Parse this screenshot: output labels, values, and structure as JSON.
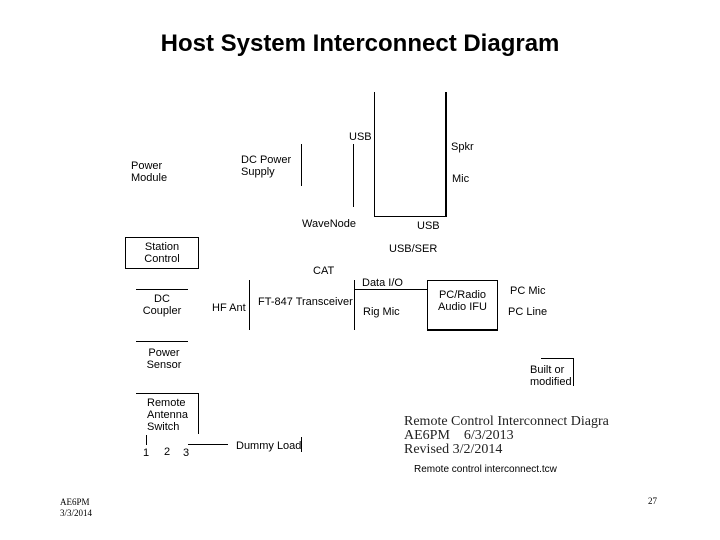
{
  "slide": {
    "title": "Host System Interconnect Diagram",
    "footer_author": "AE6PM",
    "footer_date": "3/3/2014",
    "page_number": "27"
  },
  "diagram": {
    "labels": {
      "usb_top": "USB",
      "spkr": "Spkr",
      "mic": "Mic",
      "power_module_1": "Power",
      "power_module_2": "Module",
      "dc_power_supply_1": "DC Power",
      "dc_power_supply_2": "Supply",
      "wavenode": "WaveNode",
      "usb_bottom": "USB",
      "usb_ser": "USB/SER",
      "station_control_1": "Station",
      "station_control_2": "Control",
      "cat": "CAT",
      "data_io": "Data I/O",
      "pc_radio_1": "PC/Radio",
      "pc_radio_2": "Audio IFU",
      "pc_mic": "PC Mic",
      "pc_line": "PC Line",
      "dc_coupler_1": "DC",
      "dc_coupler_2": "Coupler",
      "hf_ant": "HF Ant",
      "ft847": "FT-847 Transceiver",
      "rig_mic": "Rig Mic",
      "power_sensor_1": "Power",
      "power_sensor_2": "Sensor",
      "built_1": "Built or",
      "built_2": "modified",
      "remote_switch_1": "Remote",
      "remote_switch_2": "Antenna",
      "remote_switch_3": "Switch",
      "port_1": "1",
      "port_2": "2",
      "port_3": "3",
      "dummy_load": "Dummy Load"
    },
    "caption": {
      "line1": "Remote Control Interconnect Diagra",
      "line2": "AE6PM    6/3/2013",
      "line3": "Revised 3/2/2014",
      "filename": "Remote control interconnect.tcw"
    }
  }
}
